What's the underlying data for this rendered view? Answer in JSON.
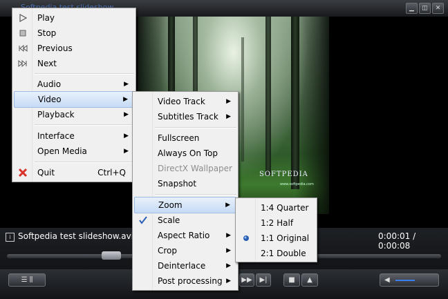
{
  "window": {
    "title": "Softpedia test slideshow"
  },
  "status": {
    "filename": "Softpedia test slideshow.avi",
    "time": "0:00:01 / 0:00:08"
  },
  "video_overlay": {
    "brand": "SOFTPEDIA",
    "url": "www.softpedia.com"
  },
  "main_menu": {
    "items": [
      {
        "label": "Play"
      },
      {
        "label": "Stop"
      },
      {
        "label": "Previous"
      },
      {
        "label": "Next"
      },
      {
        "label": "Audio"
      },
      {
        "label": "Video"
      },
      {
        "label": "Playback"
      },
      {
        "label": "Interface"
      },
      {
        "label": "Open Media"
      },
      {
        "label": "Quit",
        "shortcut": "Ctrl+Q"
      }
    ]
  },
  "video_menu": {
    "items": [
      {
        "label": "Video Track"
      },
      {
        "label": "Subtitles Track"
      },
      {
        "label": "Fullscreen"
      },
      {
        "label": "Always On Top"
      },
      {
        "label": "DirectX Wallpaper"
      },
      {
        "label": "Snapshot"
      },
      {
        "label": "Zoom"
      },
      {
        "label": "Scale"
      },
      {
        "label": "Aspect Ratio"
      },
      {
        "label": "Crop"
      },
      {
        "label": "Deinterlace"
      },
      {
        "label": "Post processing"
      }
    ]
  },
  "zoom_menu": {
    "items": [
      {
        "label": "1:4 Quarter"
      },
      {
        "label": "1:2 Half"
      },
      {
        "label": "1:1 Original"
      },
      {
        "label": "2:1 Double"
      }
    ]
  },
  "icons": {
    "play": "play-icon",
    "stop": "stop-icon",
    "previous": "previous-icon",
    "next": "next-icon",
    "quit": "quit-x-icon",
    "submenu": "submenu-arrow-icon",
    "check": "checkmark-icon",
    "radio": "radio-dot-icon"
  },
  "colors": {
    "quit_icon": "#d9322b",
    "check": "#2a5fb4",
    "highlight": "#c6dbf5"
  }
}
